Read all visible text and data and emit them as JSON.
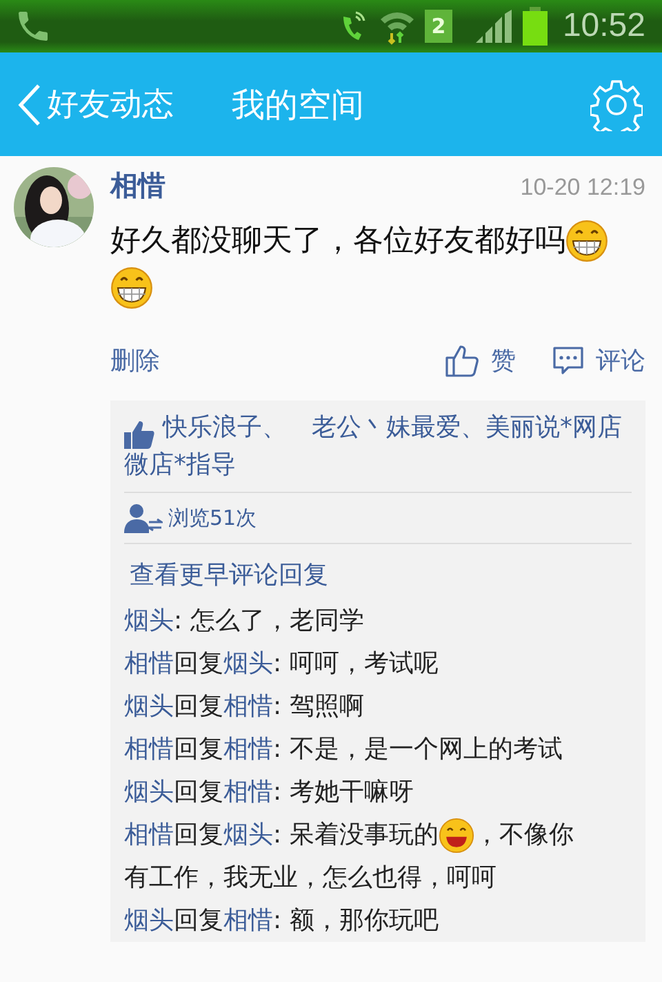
{
  "status_bar": {
    "sim": "2",
    "time": "10:52"
  },
  "header": {
    "back_label": "好友动态",
    "title": "我的空间"
  },
  "post": {
    "author": "相惜",
    "time": "10-20 12:19",
    "parts": [
      {
        "kind": "text",
        "text": "好久都没聊天了，各位好友都好吗"
      },
      {
        "kind": "grin"
      },
      {
        "kind": "grin"
      }
    ],
    "delete_label": "删除",
    "like_label": "赞",
    "comment_label": "评论"
  },
  "likes": "快乐浪子、　老公丶妹最爱、美丽说*网店微店*指导",
  "views": "浏览51次",
  "more_comments": "查看更早评论回复",
  "comments": [
    {
      "author": "烟头",
      "parts": [
        {
          "kind": "text",
          "text": ": 怎么了，老同学"
        }
      ]
    },
    {
      "author": "相惜",
      "reply_label": "回复",
      "target": "烟头",
      "parts": [
        {
          "kind": "text",
          "text": ": 呵呵，考试呢"
        }
      ]
    },
    {
      "author": "烟头",
      "reply_label": "回复",
      "target": "相惜",
      "parts": [
        {
          "kind": "text",
          "text": ": 驾照啊"
        }
      ]
    },
    {
      "author": "相惜",
      "reply_label": "回复",
      "target": "相惜",
      "parts": [
        {
          "kind": "text",
          "text": ": 不是，是一个网上的考试"
        }
      ]
    },
    {
      "author": "烟头",
      "reply_label": "回复",
      "target": "相惜",
      "parts": [
        {
          "kind": "text",
          "text": ": 考她干嘛呀"
        }
      ]
    },
    {
      "author": "相惜",
      "reply_label": "回复",
      "target": "烟头",
      "parts": [
        {
          "kind": "text",
          "text": ": 呆着没事玩的"
        },
        {
          "kind": "laugh"
        },
        {
          "kind": "text",
          "text": "，不像你"
        },
        {
          "kind": "text",
          "text": "有工作，我无业，怎么也得"
        },
        {
          "kind": "text",
          "text": "，呵呵"
        }
      ]
    },
    {
      "author": "烟头",
      "reply_label": "回复",
      "target": "相惜",
      "parts": [
        {
          "kind": "text",
          "text": ": 额，那你玩吧"
        }
      ]
    }
  ]
}
